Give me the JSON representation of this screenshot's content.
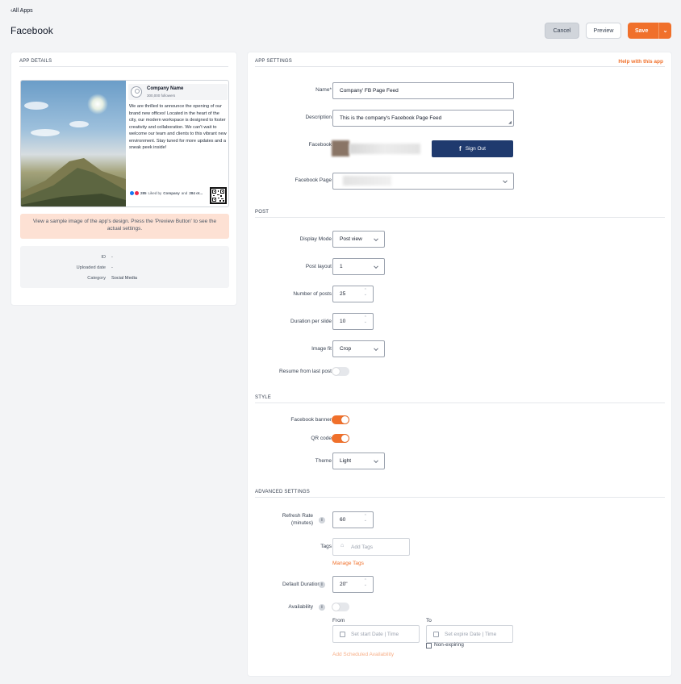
{
  "header": {
    "back_label": "All Apps",
    "title": "Facebook",
    "cancel_label": "Cancel",
    "preview_label": "Preview",
    "save_label": "Save"
  },
  "app_details": {
    "section_title": "APP DETAILS",
    "preview": {
      "company_name": "Company Name",
      "followers": "300,000 followers",
      "post_text": "We are thrilled to announce the opening of our brand new offices! Located in the heart of the city, our modern workspace is designed to foster creativity and collaboration. We can't wait to welcome our team and clients to this vibrant new environment. Stay tuned for more updates and a sneak peek inside!",
      "reactions_count": "285",
      "liked_by_prefix": "Liked by",
      "liked_by_name": "Company",
      "liked_by_and": "and",
      "liked_by_others": "284 ot..."
    },
    "note": "View a sample image of the app's design. Press the 'Preview Button' to see the actual settings.",
    "meta": [
      {
        "key": "ID",
        "value": "-"
      },
      {
        "key": "Uploaded date",
        "value": "-"
      },
      {
        "key": "Category",
        "value": "Social Media"
      }
    ]
  },
  "app_settings": {
    "section_title": "APP SETTINGS",
    "help_link": "Help with this app",
    "name_label": "Name*",
    "name_value": "Company' FB Page Feed",
    "description_label": "Description",
    "description_value": "This is the company's Facebook Page Feed",
    "facebook_label": "Facebook",
    "sign_out_label": "Sign Out",
    "facebook_page_label": "Facebook Page"
  },
  "post": {
    "section_title": "POST",
    "display_mode_label": "Display Mode",
    "display_mode_value": "Post view",
    "post_layout_label": "Post layout",
    "post_layout_value": "1",
    "number_of_posts_label": "Number of posts",
    "number_of_posts_value": "25",
    "duration_label": "Duration per slide",
    "duration_value": "10",
    "image_fit_label": "Image fit",
    "image_fit_value": "Crop",
    "resume_label": "Resume from last post",
    "resume_on": false
  },
  "style": {
    "section_title": "STYLE",
    "banner_label": "Facebook banner",
    "banner_on": true,
    "qr_label": "QR code",
    "qr_on": true,
    "theme_label": "Theme",
    "theme_value": "Light"
  },
  "advanced": {
    "section_title": "ADVANCED SETTINGS",
    "refresh_label_1": "Refresh Rate",
    "refresh_label_2": "(minutes)",
    "refresh_value": "60",
    "tags_label": "Tags",
    "tags_placeholder": "Add Tags",
    "manage_tags": "Manage Tags",
    "default_duration_label": "Default Duration",
    "default_duration_value": "20\"",
    "availability_label": "Availability",
    "availability_on": false,
    "from_label": "From",
    "from_placeholder": "Set start Date | Time",
    "to_label": "To",
    "to_placeholder": "Set expire Date | Time",
    "non_expiring_label": "Non-expiring",
    "add_scheduled": "Add Scheduled Availability"
  },
  "colors": {
    "accent": "#f0702b",
    "facebook_button": "#1f3a6e",
    "note_bg": "#fde1d4"
  }
}
